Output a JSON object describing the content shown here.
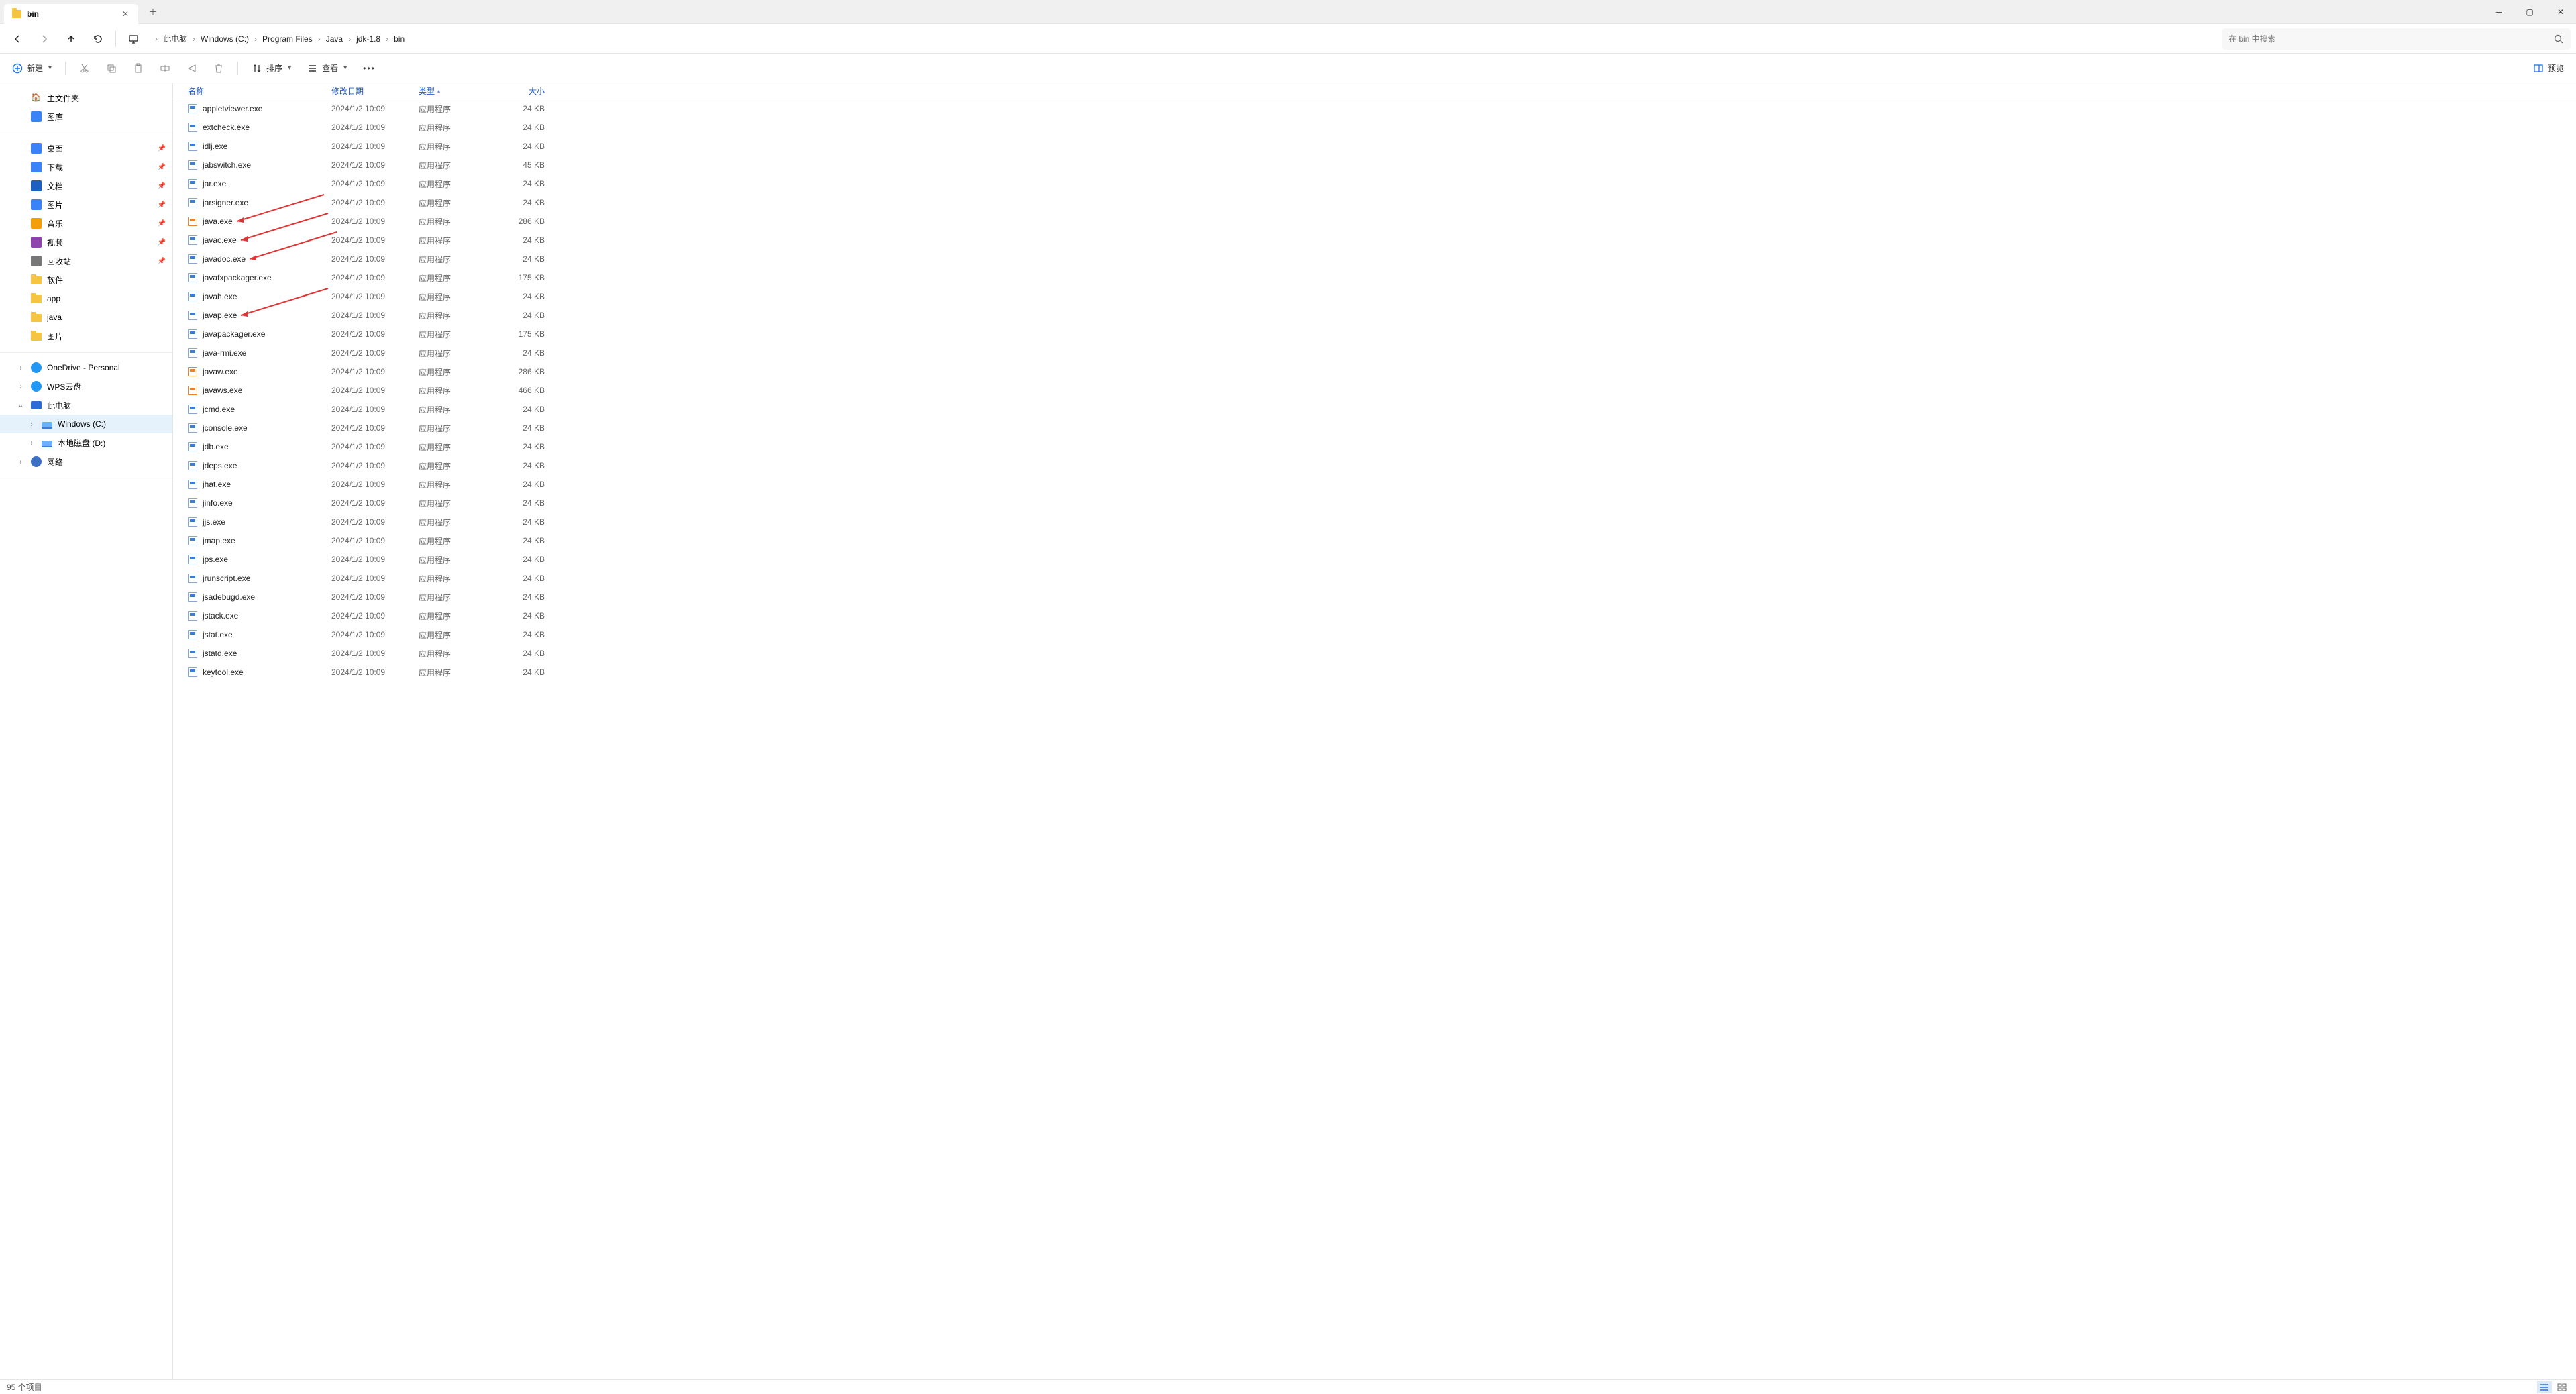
{
  "titlebar": {
    "tab_title": "bin"
  },
  "breadcrumb": {
    "monitor_label": "",
    "segments": [
      "此电脑",
      "Windows (C:)",
      "Program Files",
      "Java",
      "jdk-1.8",
      "bin"
    ]
  },
  "search": {
    "placeholder": "在 bin 中搜索"
  },
  "toolbar": {
    "new_label": "新建",
    "sort_label": "排序",
    "view_label": "查看",
    "preview_label": "预览"
  },
  "nav": {
    "group1": [
      {
        "icon": "home",
        "label": "主文件夹",
        "twisty": ""
      },
      {
        "icon": "gallery",
        "label": "图库",
        "twisty": ""
      }
    ],
    "group2": [
      {
        "icon": "blue",
        "label": "桌面",
        "pinned": true
      },
      {
        "icon": "blue",
        "label": "下载",
        "pinned": true
      },
      {
        "icon": "darkblue",
        "label": "文档",
        "pinned": true
      },
      {
        "icon": "blue",
        "label": "图片",
        "pinned": true
      },
      {
        "icon": "orange",
        "label": "音乐",
        "pinned": true
      },
      {
        "icon": "purple",
        "label": "视频",
        "pinned": true
      },
      {
        "icon": "gray",
        "label": "回收站",
        "pinned": true
      },
      {
        "icon": "folder",
        "label": "软件",
        "pinned": false
      },
      {
        "icon": "folder",
        "label": "app",
        "pinned": false
      },
      {
        "icon": "folder",
        "label": "java",
        "pinned": false
      },
      {
        "icon": "folder",
        "label": "图片",
        "pinned": false
      }
    ],
    "group3": [
      {
        "icon": "cloud",
        "label": "OneDrive - Personal",
        "twisty": ">"
      },
      {
        "icon": "cloud",
        "label": "WPS云盘",
        "twisty": ">"
      },
      {
        "icon": "monitor",
        "label": "此电脑",
        "twisty": "v"
      },
      {
        "icon": "disk",
        "label": "Windows (C:)",
        "twisty": ">",
        "indent": 1,
        "selected": true
      },
      {
        "icon": "disk",
        "label": "本地磁盘 (D:)",
        "twisty": ">",
        "indent": 1
      },
      {
        "icon": "net",
        "label": "网络",
        "twisty": ">"
      }
    ]
  },
  "columns": {
    "name": "名称",
    "date": "修改日期",
    "type": "类型",
    "size": "大小"
  },
  "date_value": "2024/1/2 10:09",
  "type_value": "应用程序",
  "files": [
    {
      "name": "appletviewer.exe",
      "size": "24 KB",
      "ico": "exe"
    },
    {
      "name": "extcheck.exe",
      "size": "24 KB",
      "ico": "exe"
    },
    {
      "name": "idlj.exe",
      "size": "24 KB",
      "ico": "exe"
    },
    {
      "name": "jabswitch.exe",
      "size": "45 KB",
      "ico": "exe"
    },
    {
      "name": "jar.exe",
      "size": "24 KB",
      "ico": "exe"
    },
    {
      "name": "jarsigner.exe",
      "size": "24 KB",
      "ico": "exe"
    },
    {
      "name": "java.exe",
      "size": "286 KB",
      "ico": "java",
      "arrow": true
    },
    {
      "name": "javac.exe",
      "size": "24 KB",
      "ico": "exe",
      "arrow": true
    },
    {
      "name": "javadoc.exe",
      "size": "24 KB",
      "ico": "exe",
      "arrow": true
    },
    {
      "name": "javafxpackager.exe",
      "size": "175 KB",
      "ico": "exe"
    },
    {
      "name": "javah.exe",
      "size": "24 KB",
      "ico": "exe"
    },
    {
      "name": "javap.exe",
      "size": "24 KB",
      "ico": "exe",
      "arrow": true
    },
    {
      "name": "javapackager.exe",
      "size": "175 KB",
      "ico": "exe"
    },
    {
      "name": "java-rmi.exe",
      "size": "24 KB",
      "ico": "exe"
    },
    {
      "name": "javaw.exe",
      "size": "286 KB",
      "ico": "java"
    },
    {
      "name": "javaws.exe",
      "size": "466 KB",
      "ico": "java"
    },
    {
      "name": "jcmd.exe",
      "size": "24 KB",
      "ico": "exe"
    },
    {
      "name": "jconsole.exe",
      "size": "24 KB",
      "ico": "exe"
    },
    {
      "name": "jdb.exe",
      "size": "24 KB",
      "ico": "exe"
    },
    {
      "name": "jdeps.exe",
      "size": "24 KB",
      "ico": "exe"
    },
    {
      "name": "jhat.exe",
      "size": "24 KB",
      "ico": "exe"
    },
    {
      "name": "jinfo.exe",
      "size": "24 KB",
      "ico": "exe"
    },
    {
      "name": "jjs.exe",
      "size": "24 KB",
      "ico": "exe"
    },
    {
      "name": "jmap.exe",
      "size": "24 KB",
      "ico": "exe"
    },
    {
      "name": "jps.exe",
      "size": "24 KB",
      "ico": "exe"
    },
    {
      "name": "jrunscript.exe",
      "size": "24 KB",
      "ico": "exe"
    },
    {
      "name": "jsadebugd.exe",
      "size": "24 KB",
      "ico": "exe"
    },
    {
      "name": "jstack.exe",
      "size": "24 KB",
      "ico": "exe"
    },
    {
      "name": "jstat.exe",
      "size": "24 KB",
      "ico": "exe"
    },
    {
      "name": "jstatd.exe",
      "size": "24 KB",
      "ico": "exe"
    },
    {
      "name": "keytool.exe",
      "size": "24 KB",
      "ico": "exe"
    }
  ],
  "status": {
    "count_label": "95 个项目"
  }
}
